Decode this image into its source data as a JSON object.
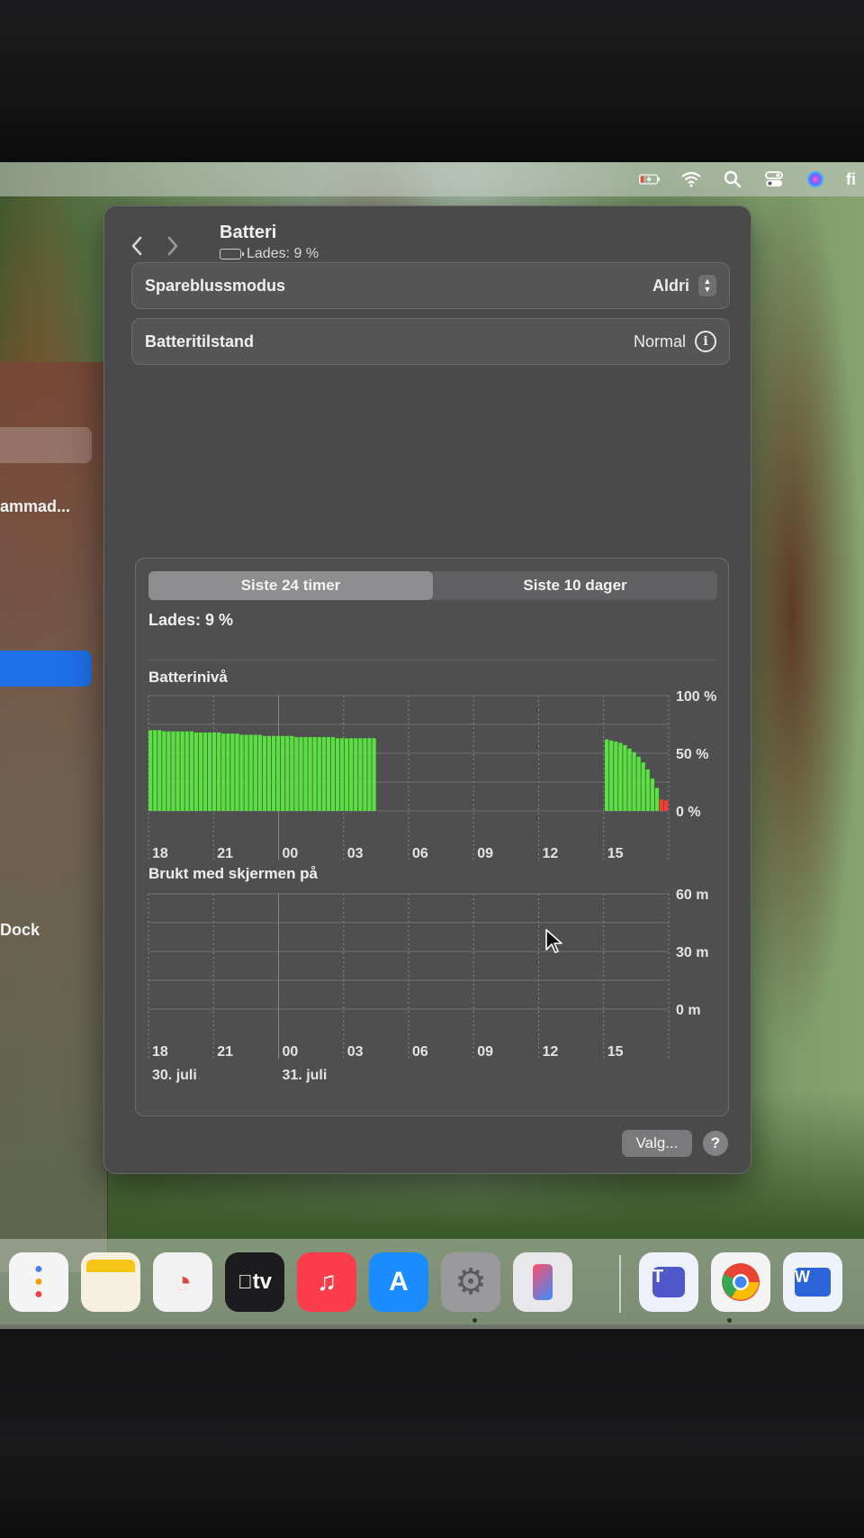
{
  "menubar": {
    "trailing_text": "fi",
    "icons": [
      "battery-charging-icon",
      "wifi-icon",
      "search-icon",
      "control-center-icon",
      "siri-icon"
    ]
  },
  "sidebar": {
    "item_truncated": "ammad...",
    "item_dock": "Dock"
  },
  "window": {
    "title": "Batteri",
    "subtitle": "Lades: 9 %",
    "low_power_label": "Spareblussmodus",
    "low_power_value": "Aldri",
    "health_label": "Batteritilstand",
    "health_value": "Normal",
    "tabs": [
      {
        "label": "Siste 24 timer",
        "active": true
      },
      {
        "label": "Siste 10 dager",
        "active": false
      }
    ],
    "status": "Lades: 9 %",
    "options_button": "Valg...",
    "help_button": "?"
  },
  "chart_data": [
    {
      "type": "bar",
      "title": "Batterinivå",
      "y_ticks": [
        "100 %",
        "50 %",
        "0 %"
      ],
      "ylim": [
        0,
        100
      ],
      "x_ticks": [
        "18",
        "21",
        "00",
        "03",
        "06",
        "09",
        "12",
        "15"
      ],
      "series": [
        {
          "values": [
            70,
            70,
            70,
            69,
            69,
            69,
            69,
            69,
            69,
            69,
            68,
            68,
            68,
            68,
            68,
            68,
            67,
            67,
            67,
            67,
            66,
            66,
            66,
            66,
            66,
            65,
            65,
            65,
            65,
            65,
            65,
            65,
            64,
            64,
            64,
            64,
            64,
            64,
            64,
            64,
            64,
            63,
            63,
            63,
            63,
            63,
            63,
            63,
            63,
            63,
            0,
            0,
            0,
            0,
            0,
            0,
            0,
            0,
            0,
            0,
            0,
            0,
            0,
            0,
            0,
            0,
            0,
            0,
            0,
            0,
            0,
            0,
            0,
            0,
            0,
            0,
            0,
            0,
            0,
            0,
            0,
            0,
            0,
            0,
            0,
            0,
            0,
            0,
            0,
            0,
            0,
            0,
            0,
            0,
            0,
            0,
            0,
            0,
            0,
            0,
            62,
            61,
            60,
            59,
            57,
            54,
            51,
            47,
            42,
            36,
            28,
            20,
            10,
            9
          ]
        }
      ],
      "colors": {
        "bar": "#58e23f",
        "low": "#ff3b30"
      },
      "low_threshold": 10
    },
    {
      "type": "bar",
      "title": "Brukt med skjermen på",
      "y_ticks": [
        "60 m",
        "30 m",
        "0 m"
      ],
      "ylim": [
        0,
        60
      ],
      "x_ticks": [
        "18",
        "21",
        "00",
        "03",
        "06",
        "09",
        "12",
        "15"
      ],
      "date_labels": [
        "30. juli",
        "31. juli"
      ],
      "series": [
        {
          "values": []
        }
      ]
    }
  ],
  "dock": {
    "apps": [
      {
        "name": "reminders",
        "color": "#f4f4f4"
      },
      {
        "name": "notes",
        "color": "#f6f1df"
      },
      {
        "name": "freeform",
        "color": "#f2f2f2"
      },
      {
        "name": "tv",
        "color": "#1c1c1e",
        "label": "tv"
      },
      {
        "name": "music",
        "color": "#fa3c4c"
      },
      {
        "name": "app-store",
        "color": "#1a8cff"
      },
      {
        "name": "system-settings",
        "color": "#9a9a9c"
      },
      {
        "name": "iphone-mirroring",
        "color": "#e8e8ea"
      },
      {
        "name": "teams",
        "color": "#eef0fa"
      },
      {
        "name": "chrome",
        "color": "#f4f4f4"
      },
      {
        "name": "word",
        "color": "#eef2fa"
      }
    ]
  }
}
